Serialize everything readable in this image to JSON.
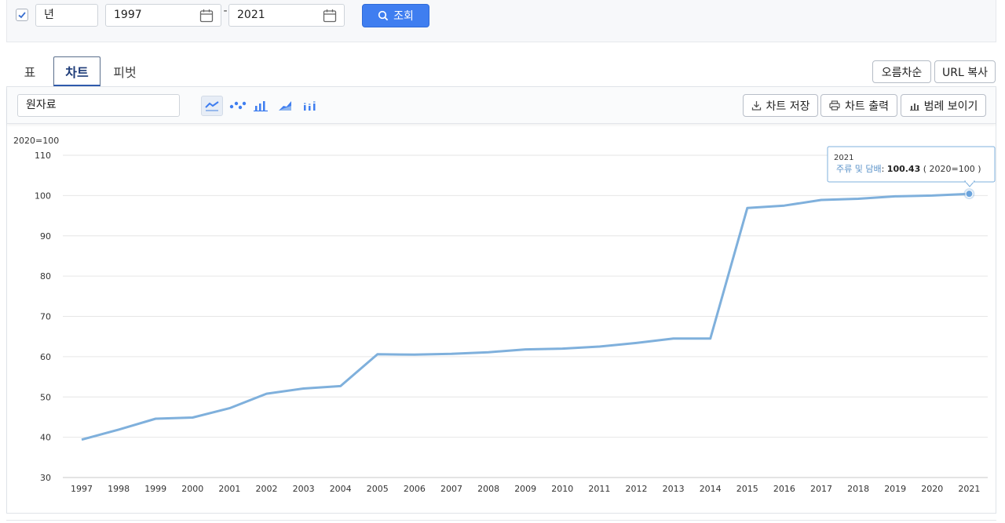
{
  "filter": {
    "period_unit": "년",
    "checkbox_checked": true,
    "date_from": "1997",
    "date_separator": "-",
    "date_to": "2021",
    "search_label": "조회"
  },
  "tabs": [
    {
      "label": "표",
      "active": false
    },
    {
      "label": "차트",
      "active": true
    },
    {
      "label": "피벗",
      "active": false
    }
  ],
  "actions": {
    "sort_label": "오름차순",
    "url_copy_label": "URL 복사"
  },
  "chart_toolbar": {
    "series_select": "원자료",
    "chart_types": [
      {
        "icon": "line-chart-icon",
        "active": true
      },
      {
        "icon": "scatter-chart-icon",
        "active": false
      },
      {
        "icon": "bar-chart-icon",
        "active": false
      },
      {
        "icon": "area-chart-icon",
        "active": false
      },
      {
        "icon": "stacked-bar-chart-icon",
        "active": false
      }
    ],
    "save_label": "차트 저장",
    "print_label": "차트 출력",
    "legend_label": "범례 보이기"
  },
  "colors": {
    "accent": "#3f7ef0",
    "series": "#7fb0dc",
    "grid": "#e6e6e6"
  },
  "chart_data": {
    "type": "line",
    "unit_label": "2020=100",
    "categories": [
      "1997",
      "1998",
      "1999",
      "2000",
      "2001",
      "2002",
      "2003",
      "2004",
      "2005",
      "2006",
      "2007",
      "2008",
      "2009",
      "2010",
      "2011",
      "2012",
      "2013",
      "2014",
      "2015",
      "2016",
      "2017",
      "2018",
      "2019",
      "2020",
      "2021"
    ],
    "series": [
      {
        "name": "주류 및 담배",
        "values": [
          39.4,
          41.9,
          44.6,
          44.9,
          47.2,
          50.8,
          52.1,
          52.7,
          60.6,
          60.5,
          60.7,
          61.1,
          61.8,
          62.0,
          62.5,
          63.4,
          64.5,
          64.5,
          96.9,
          97.5,
          98.9,
          99.2,
          99.8,
          100.0,
          100.43
        ]
      }
    ],
    "ylim": [
      30,
      110
    ],
    "yticks": [
      "30",
      "40",
      "50",
      "60",
      "70",
      "80",
      "90",
      "100",
      "110"
    ],
    "grid": true,
    "legend": "hidden",
    "tooltip": {
      "year": "2021",
      "series_label": "주류 및 담배",
      "value": "100.43",
      "unit": "( 2020=100 )"
    }
  }
}
